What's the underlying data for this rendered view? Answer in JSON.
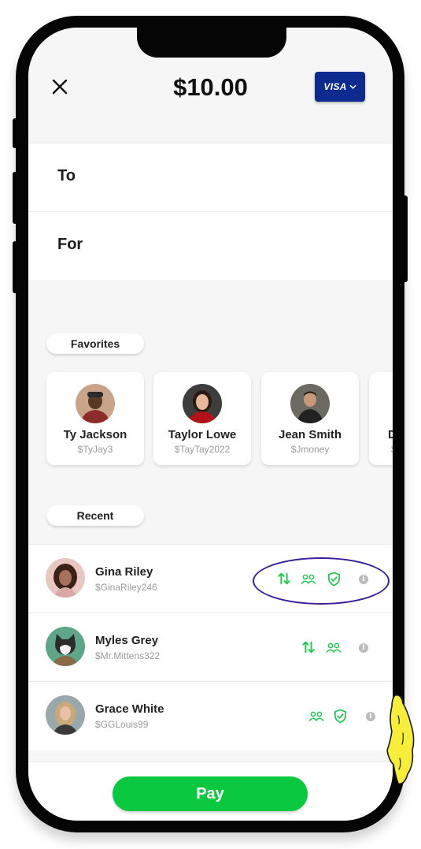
{
  "header": {
    "amount": "$10.00",
    "card_label": "VISA"
  },
  "form": {
    "to_label": "To",
    "for_label": "For"
  },
  "favorites": {
    "title": "Favorites",
    "items": [
      {
        "name": "Ty Jackson",
        "handle": "$TyJay3"
      },
      {
        "name": "Taylor Lowe",
        "handle": "$TayTay2022"
      },
      {
        "name": "Jean Smith",
        "handle": "$Jmoney"
      },
      {
        "name": "D",
        "handle": "$"
      }
    ]
  },
  "recent": {
    "title": "Recent",
    "items": [
      {
        "name": "Gina Riley",
        "handle": "$GinaRiley246",
        "icons": [
          "transfer-icon",
          "group-icon",
          "shield-check-icon",
          "info-icon"
        ]
      },
      {
        "name": "Myles Grey",
        "handle": "$Mr.Mittens322",
        "icons": [
          "transfer-icon",
          "group-icon",
          "info-icon"
        ]
      },
      {
        "name": "Grace White",
        "handle": "$GGLouis99",
        "icons": [
          "group-icon",
          "shield-check-icon",
          "info-icon"
        ]
      }
    ]
  },
  "info_glyph": "i",
  "actions": {
    "pay_label": "Pay"
  },
  "colors": {
    "brand_green": "#0ac940",
    "card_blue": "#0d2a8e",
    "icon_green": "#1ec94c",
    "highlight_ring": "#3b1f9a",
    "scribble_yellow": "#f7ee3a"
  }
}
